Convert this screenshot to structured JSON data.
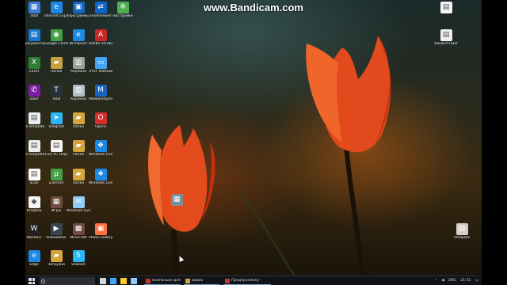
{
  "watermark": "www.Bandicam.com",
  "desktop_icons": [
    {
      "label": "Total",
      "icon": "folder-icon",
      "color": "#3a7bd5",
      "glyph": "▦"
    },
    {
      "label": "Internet Explorer",
      "icon": "ie-icon",
      "color": "#1e88e5",
      "glyph": "e"
    },
    {
      "label": "Программы",
      "icon": "app-icon",
      "color": "#1565c0",
      "glyph": "▣"
    },
    {
      "label": "TeamViewer",
      "icon": "teamviewer-icon",
      "color": "#0d63c6",
      "glyph": "⇄"
    },
    {
      "label": "Настройки",
      "icon": "settings-icon",
      "color": "#4caf50",
      "glyph": "✲"
    },
    {
      "label": "Документы",
      "icon": "document-icon",
      "color": "#1976d2",
      "glyph": "▤"
    },
    {
      "label": "Google Chrome",
      "icon": "chrome-icon",
      "color": "#43a047",
      "glyph": "◉"
    },
    {
      "label": "Интернет",
      "icon": "ie-icon",
      "color": "#1e88e5",
      "glyph": "e"
    },
    {
      "label": "Adobe Acrobat",
      "icon": "acrobat-icon",
      "color": "#c62828",
      "glyph": "A"
    },
    {
      "label": "Excel",
      "icon": "excel-icon",
      "color": "#2e7d32",
      "glyph": "X"
    },
    {
      "label": "Папка",
      "icon": "folder-icon",
      "color": "#c8a040",
      "glyph": "▰"
    },
    {
      "label": "Корзина",
      "icon": "recycle-bin-icon",
      "color": "#9e9e9e",
      "glyph": "▥"
    },
    {
      "label": "Этот компьютер",
      "icon": "computer-icon",
      "color": "#42a5f5",
      "glyph": "▭"
    },
    {
      "label": "Viber",
      "icon": "viber-icon",
      "color": "#7b1fa2",
      "glyph": "✆"
    },
    {
      "label": "Total",
      "icon": "app-icon",
      "color": "#263238",
      "glyph": "T"
    },
    {
      "label": "Корзина",
      "icon": "recycle-bin-icon",
      "color": "#b0bec5",
      "glyph": "▥"
    },
    {
      "label": "Malwarebytes",
      "icon": "malwarebytes-icon",
      "color": "#1565c0",
      "glyph": "M"
    },
    {
      "label": "CVTemplate",
      "icon": "document-icon",
      "color": "#eceff1",
      "glyph": "▤"
    },
    {
      "label": "Telegram",
      "icon": "telegram-icon",
      "color": "#29b6f6",
      "glyph": "➤"
    },
    {
      "label": "папка",
      "icon": "folder-icon",
      "color": "#d4a53c",
      "glyph": "▰"
    },
    {
      "label": "Opera",
      "icon": "opera-icon",
      "color": "#d32f2f",
      "glyph": "O"
    },
    {
      "label": "CVTemplate",
      "icon": "document-icon",
      "color": "#eceff1",
      "glyph": "▤"
    },
    {
      "label": "Live PC Help",
      "icon": "document-icon",
      "color": "#f5f5f5",
      "glyph": "▤"
    },
    {
      "label": "папка",
      "icon": "folder-icon",
      "color": "#d4a53c",
      "glyph": "▰"
    },
    {
      "label": "Windows Live",
      "icon": "windows-live-icon",
      "color": "#1e88e5",
      "glyph": "❖"
    },
    {
      "label": "Scan",
      "icon": "document-icon",
      "color": "#fafafa",
      "glyph": "▤"
    },
    {
      "label": "uTorrent",
      "icon": "utorrent-icon",
      "color": "#43a047",
      "glyph": "µ"
    },
    {
      "label": "папка",
      "icon": "folder-icon",
      "color": "#d4a53c",
      "glyph": "▰"
    },
    {
      "label": "Windows Live",
      "icon": "windows-live-icon",
      "color": "#1e88e5",
      "glyph": "❖"
    },
    {
      "label": "Dropbox",
      "icon": "dropbox-icon",
      "color": "#f5f5f5",
      "glyph": "◆"
    },
    {
      "label": "Игры",
      "icon": "games-icon",
      "color": "#6d4c41",
      "glyph": "▦"
    },
    {
      "label": "Windows Live Mail",
      "icon": "mail-icon",
      "color": "#90caf9",
      "glyph": "✉"
    },
    {
      "label": "Warface",
      "icon": "warface-icon",
      "color": "#212121",
      "glyph": "W"
    },
    {
      "label": "Videoeditor",
      "icon": "video-icon",
      "color": "#37474f",
      "glyph": "▶"
    },
    {
      "label": "Minecraft",
      "icon": "minecraft-icon",
      "color": "#6d4c41",
      "glyph": "▩"
    },
    {
      "label": "Photo Gallery",
      "icon": "photo-icon",
      "color": "#ff7043",
      "glyph": "▣"
    },
    {
      "label": "Edge",
      "icon": "ie-icon",
      "color": "#1e88e5",
      "glyph": "e"
    },
    {
      "label": "Загрузки",
      "icon": "folder-icon",
      "color": "#d4a53c",
      "glyph": "▰"
    },
    {
      "label": "Shazam",
      "icon": "shazam-icon",
      "color": "#29b6f6",
      "glyph": "S"
    },
    {
      "label": "",
      "icon": "file-icon",
      "color": "#f5f5f5",
      "glyph": "▤"
    },
    {
      "label": "Хиханп-Пиоги",
      "icon": "file-icon",
      "color": "#eeeeee",
      "glyph": "▤"
    },
    {
      "label": "Uhelpme",
      "icon": "file-icon",
      "color": "#d7ccc8",
      "glyph": "▤"
    },
    {
      "label": "",
      "icon": "app-icon",
      "color": "#78909c",
      "glyph": "▦"
    }
  ],
  "taskbar": {
    "search_placeholder": "",
    "items": [
      {
        "label": "",
        "icon": "task-view-icon",
        "color": "#cfd8dc"
      },
      {
        "label": "",
        "icon": "edge-icon",
        "color": "#42a5f5"
      },
      {
        "label": "",
        "icon": "explorer-icon",
        "color": "#ffca28"
      },
      {
        "label": "",
        "icon": "store-icon",
        "color": "#90caf9"
      }
    ],
    "windows": [
      {
        "label": "компаньон для видео...",
        "icon": "app-icon"
      },
      {
        "label": "видео",
        "icon": "folder-icon"
      },
      {
        "label": "Предпросмотр - Рем...",
        "icon": "app-icon"
      }
    ],
    "tray": {
      "lang": "ENG",
      "time": "21:51"
    }
  },
  "colors": {
    "taskbar": "#101418",
    "active_underline": "#78a0d0"
  }
}
